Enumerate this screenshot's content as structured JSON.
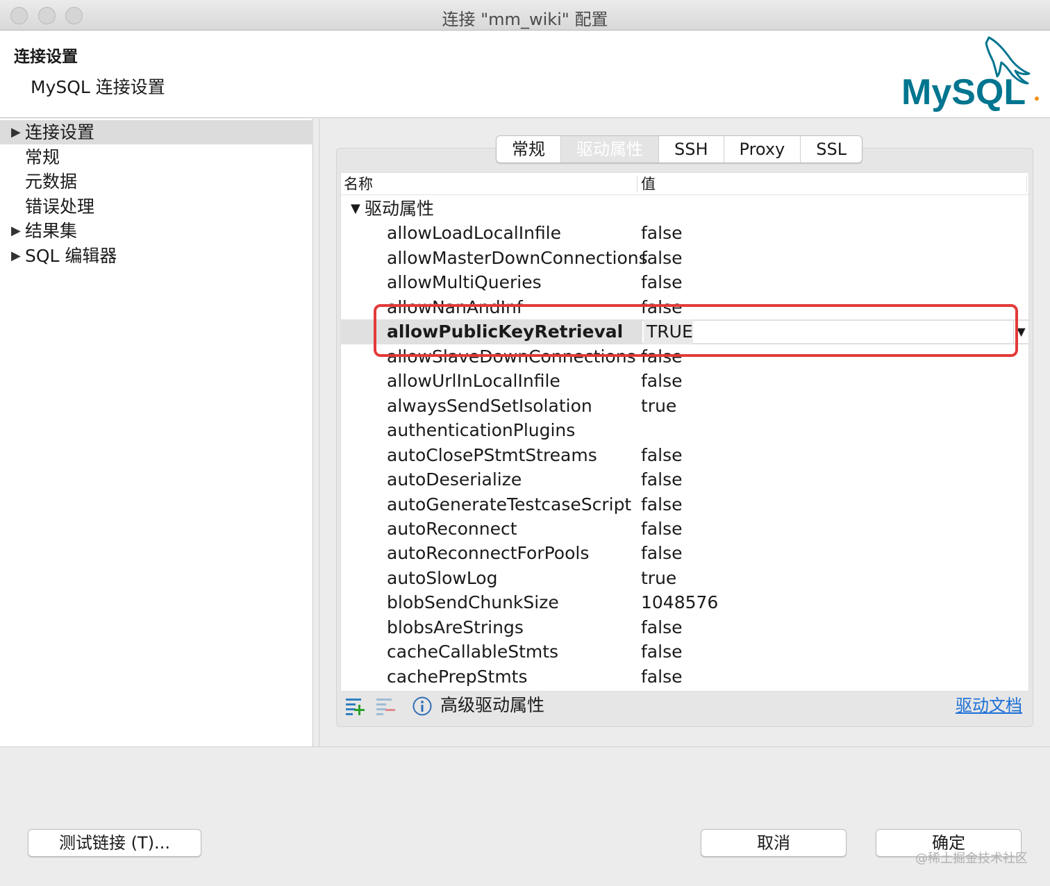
{
  "window": {
    "title": "连接 \"mm_wiki\" 配置"
  },
  "header": {
    "title": "连接设置",
    "subtitle": "MySQL 连接设置",
    "logo_text": "MySQL"
  },
  "sidebar": {
    "items": [
      {
        "label": "连接设置",
        "expandable": true,
        "selected": true
      },
      {
        "label": "常规",
        "expandable": false
      },
      {
        "label": "元数据",
        "expandable": false
      },
      {
        "label": "错误处理",
        "expandable": false
      },
      {
        "label": "结果集",
        "expandable": true
      },
      {
        "label": "SQL 编辑器",
        "expandable": true
      }
    ]
  },
  "tabs": [
    {
      "label": "常规"
    },
    {
      "label": "驱动属性",
      "active": true
    },
    {
      "label": "SSH"
    },
    {
      "label": "Proxy"
    },
    {
      "label": "SSL"
    }
  ],
  "table": {
    "col_name": "名称",
    "col_value": "值",
    "group_label": "驱动属性",
    "rows": [
      {
        "name": "allowLoadLocalInfile",
        "value": "false"
      },
      {
        "name": "allowMasterDownConnections",
        "value": "false"
      },
      {
        "name": "allowMultiQueries",
        "value": "false"
      },
      {
        "name": "allowNanAndInf",
        "value": "false"
      },
      {
        "name": "allowPublicKeyRetrieval",
        "value": "TRUE",
        "editing": true
      },
      {
        "name": "allowSlaveDownConnections",
        "value": "false"
      },
      {
        "name": "allowUrlInLocalInfile",
        "value": "false"
      },
      {
        "name": "alwaysSendSetIsolation",
        "value": "true"
      },
      {
        "name": "authenticationPlugins",
        "value": ""
      },
      {
        "name": "autoClosePStmtStreams",
        "value": "false"
      },
      {
        "name": "autoDeserialize",
        "value": "false"
      },
      {
        "name": "autoGenerateTestcaseScript",
        "value": "false"
      },
      {
        "name": "autoReconnect",
        "value": "false"
      },
      {
        "name": "autoReconnectForPools",
        "value": "false"
      },
      {
        "name": "autoSlowLog",
        "value": "true"
      },
      {
        "name": "blobSendChunkSize",
        "value": "1048576"
      },
      {
        "name": "blobsAreStrings",
        "value": "false"
      },
      {
        "name": "cacheCallableStmts",
        "value": "false"
      },
      {
        "name": "cachePrepStmts",
        "value": "false"
      }
    ]
  },
  "toolbar": {
    "advanced_label": "高级驱动属性",
    "docs_link": "驱动文档"
  },
  "buttons": {
    "test": "测试链接 (T)...",
    "cancel": "取消",
    "ok": "确定"
  },
  "watermark": "@稀土掘金技术社区",
  "colors": {
    "highlight": "#e33a3a",
    "link": "#1b6fd6",
    "logo_blue": "#00758f",
    "logo_orange": "#f29111"
  }
}
